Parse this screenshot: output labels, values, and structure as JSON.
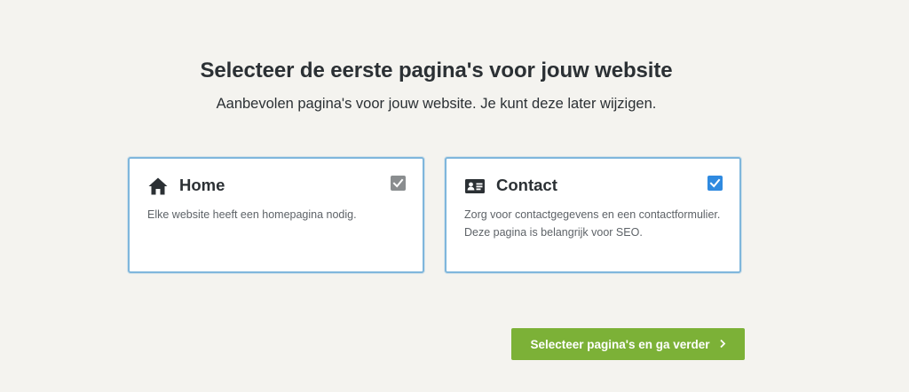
{
  "header": {
    "title": "Selecteer de eerste pagina's voor jouw website",
    "subtitle": "Aanbevolen pagina's voor jouw website. Je kunt deze later wijzigen."
  },
  "cards": [
    {
      "icon": "home-icon",
      "title": "Home",
      "description": "Elke website heeft een homepagina nodig.",
      "checked": true,
      "locked": true
    },
    {
      "icon": "contact-card-icon",
      "title": "Contact",
      "description": "Zorg voor contactgegevens en een contactformulier. Deze pagina is belangrijk voor SEO.",
      "checked": true,
      "locked": false
    }
  ],
  "actions": {
    "continue_label": "Selecteer pagina's en ga verder",
    "continue_icon": "chevron-right-icon"
  },
  "colors": {
    "background": "#f4f3ef",
    "card_border": "#7fb6dc",
    "checkbox_active": "#2f8ae0",
    "checkbox_disabled": "#8a8d8f",
    "primary_button": "#7cb137"
  }
}
